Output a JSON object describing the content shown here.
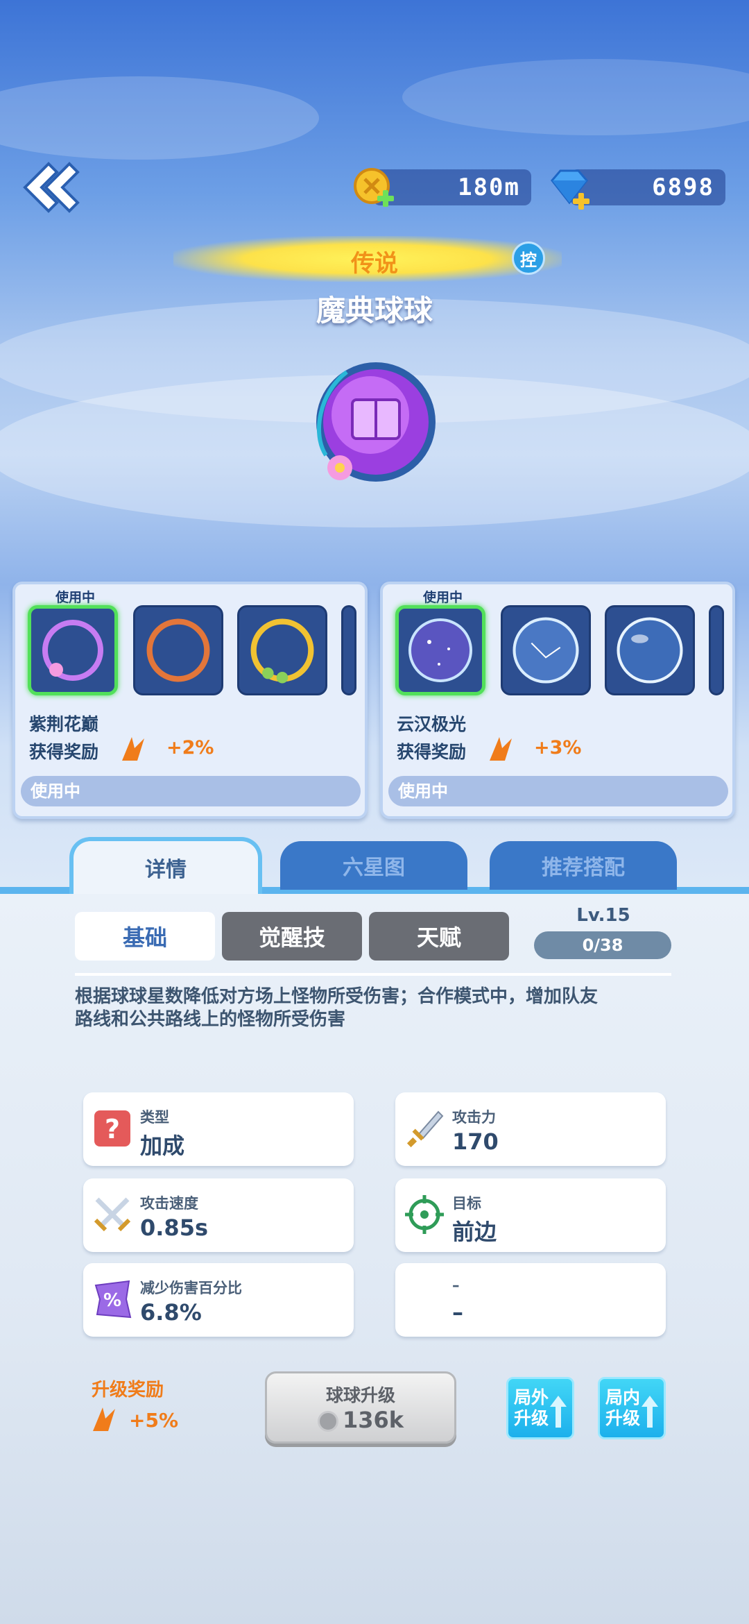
{
  "header": {
    "coins": "180m",
    "gems": "6898"
  },
  "ball": {
    "rarity": "传说",
    "control_badge": "控",
    "name": "魔典球球"
  },
  "skins": {
    "left": {
      "in_use_tag": "使用中",
      "name": "紫荆花巅",
      "reward_label": "获得奖励",
      "reward_value": "+2%",
      "button_label": "使用中"
    },
    "right": {
      "in_use_tag": "使用中",
      "name": "云汉极光",
      "reward_label": "获得奖励",
      "reward_value": "+3%",
      "button_label": "使用中"
    }
  },
  "tabs": [
    {
      "label": "详情"
    },
    {
      "label": "六星图"
    },
    {
      "label": "推荐搭配"
    }
  ],
  "subtabs": [
    {
      "label": "基础"
    },
    {
      "label": "觉醒技"
    },
    {
      "label": "天赋"
    }
  ],
  "level": {
    "label": "Lv.15",
    "progress": "0/38"
  },
  "description": "根据球球星数降低对方场上怪物所受伤害；合作模式中，增加队友路线和公共路线上的怪物所受伤害",
  "stats": [
    {
      "label": "类型",
      "value": "加成",
      "icon": "question-icon"
    },
    {
      "label": "攻击力",
      "value": "170",
      "icon": "sword-icon"
    },
    {
      "label": "攻击速度",
      "value": "0.85s",
      "icon": "crossed-swords-icon"
    },
    {
      "label": "目标",
      "value": "前边",
      "icon": "crosshair-icon"
    },
    {
      "label": "减少伤害百分比",
      "value": "6.8%",
      "icon": "percent-icon"
    },
    {
      "label": "–",
      "value": "–",
      "icon": ""
    }
  ],
  "upgrade": {
    "reward_label": "升级奖励",
    "reward_value": "+5%",
    "button_title": "球球升级",
    "cost": "136k",
    "outside_label": "局外升级",
    "inside_label": "局内升级"
  },
  "colors": {
    "accent_orange": "#f07c1a",
    "active_green": "#52e05a",
    "tab_blue": "#3a78c8",
    "cyan_button": "#1cb0ec"
  }
}
